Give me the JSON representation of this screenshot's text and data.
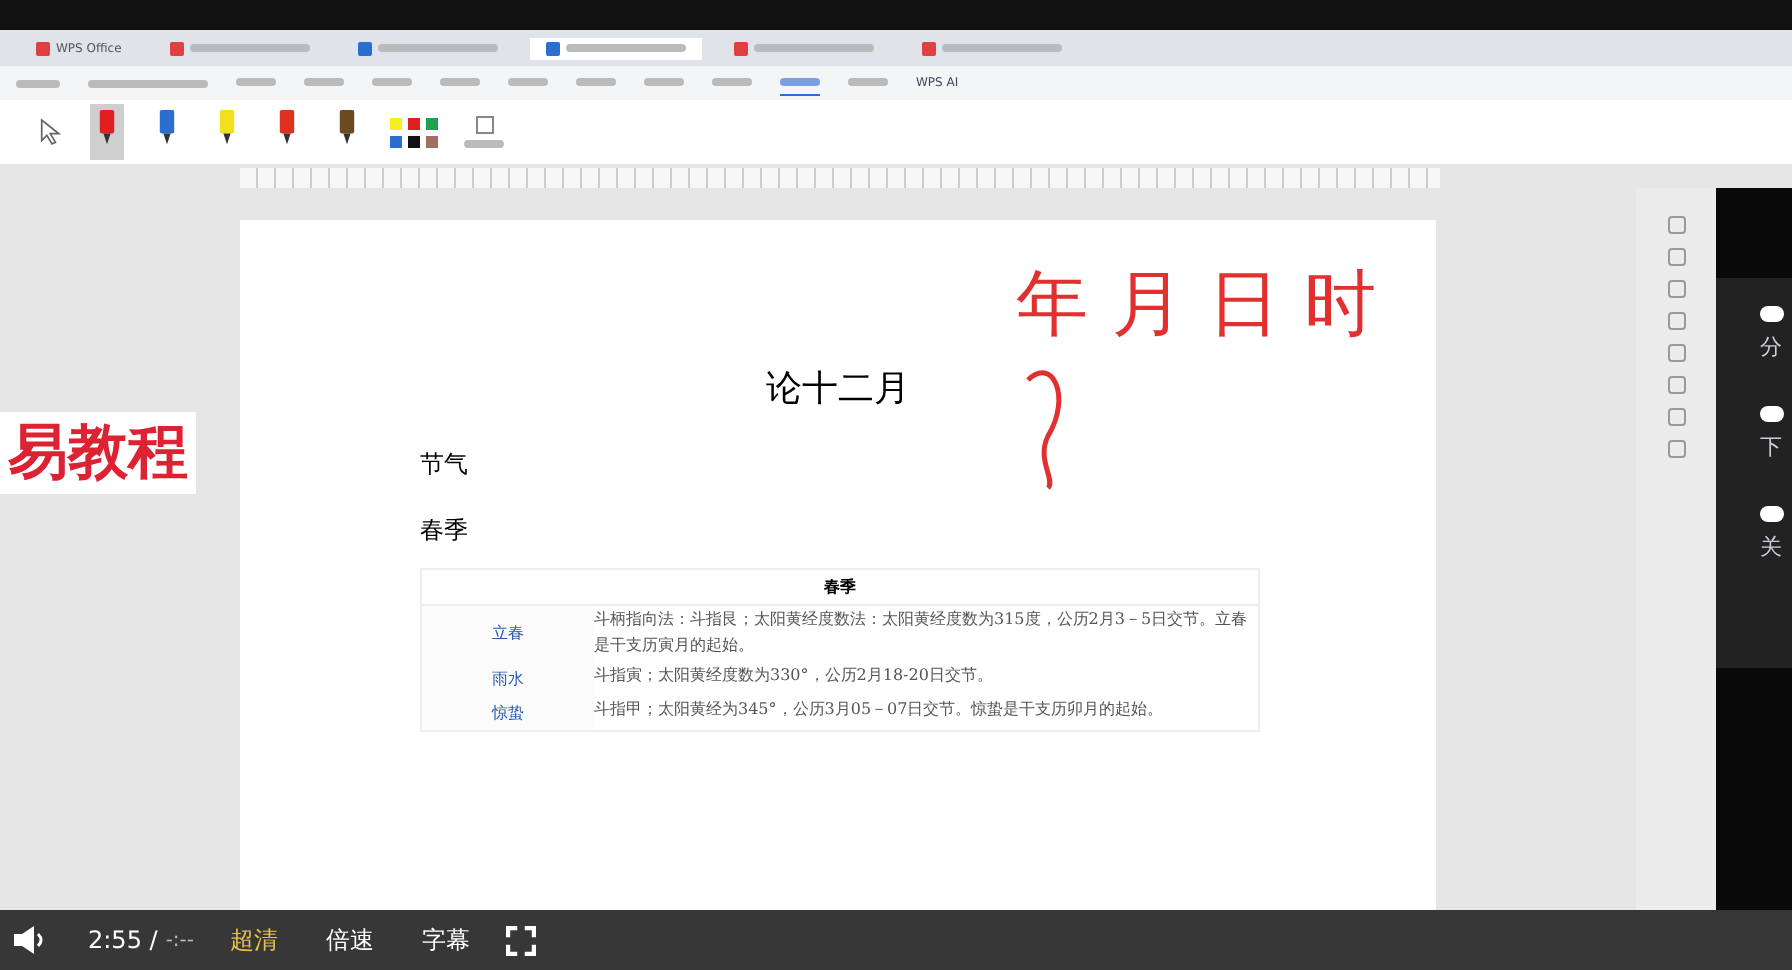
{
  "app_tabs": [
    {
      "kind": "home",
      "label": "WPS Office",
      "selected": false
    },
    {
      "kind": "pdf",
      "selected": false
    },
    {
      "kind": "doc",
      "selected": false
    },
    {
      "kind": "doc",
      "selected": true
    },
    {
      "kind": "pdf",
      "selected": false
    },
    {
      "kind": "pdf",
      "selected": false
    }
  ],
  "ribbon_menu": [
    {
      "selected": false
    },
    {
      "selected": false
    },
    {
      "selected": false
    },
    {
      "selected": false
    },
    {
      "selected": false
    },
    {
      "selected": false
    },
    {
      "selected": false
    },
    {
      "selected": false
    },
    {
      "selected": true
    },
    {
      "selected": false
    },
    {
      "label": "WPS AI",
      "selected": false
    }
  ],
  "pens": [
    {
      "color": "#e02020",
      "selected": true
    },
    {
      "color": "#2a6fd0",
      "selected": false
    },
    {
      "color": "#f0e020",
      "selected": false
    },
    {
      "color": "#e03020",
      "selected": false
    },
    {
      "color": "#6a4a20",
      "selected": false
    }
  ],
  "swatches": [
    {
      "color": "#f5f020"
    },
    {
      "color": "#e02020"
    },
    {
      "color": "#20a050"
    },
    {
      "color": "#2a6fd0"
    },
    {
      "color": "#111111"
    },
    {
      "color": "#a07060"
    }
  ],
  "overlay_caption": "易教程",
  "document": {
    "title": "论十二月",
    "headings": [
      "节气",
      "春季"
    ],
    "table": {
      "heading": "春季",
      "rows": [
        {
          "term": "立春",
          "text": "斗柄指向法：斗指艮；太阳黄经度数法：太阳黄经度数为315度，公历2月3－5日交节。立春是干支历寅月的起始。"
        },
        {
          "term": "雨水",
          "text": "斗指寅；太阳黄经度数为330°，公历2月18-20日交节。"
        },
        {
          "term": "惊蛰",
          "text": "斗指甲；太阳黄经为345°，公历3月05－07日交节。惊蛰是干支历卯月的起始。"
        }
      ]
    }
  },
  "handwriting": [
    "年",
    "月",
    "日",
    "时"
  ],
  "side_panel": [
    "分",
    "下",
    "关"
  ],
  "player": {
    "time": "2:55 /",
    "duration": "-:--",
    "controls": [
      {
        "label": "超清",
        "selected": true
      },
      {
        "label": "倍速",
        "selected": false
      },
      {
        "label": "字幕",
        "selected": false
      }
    ]
  }
}
